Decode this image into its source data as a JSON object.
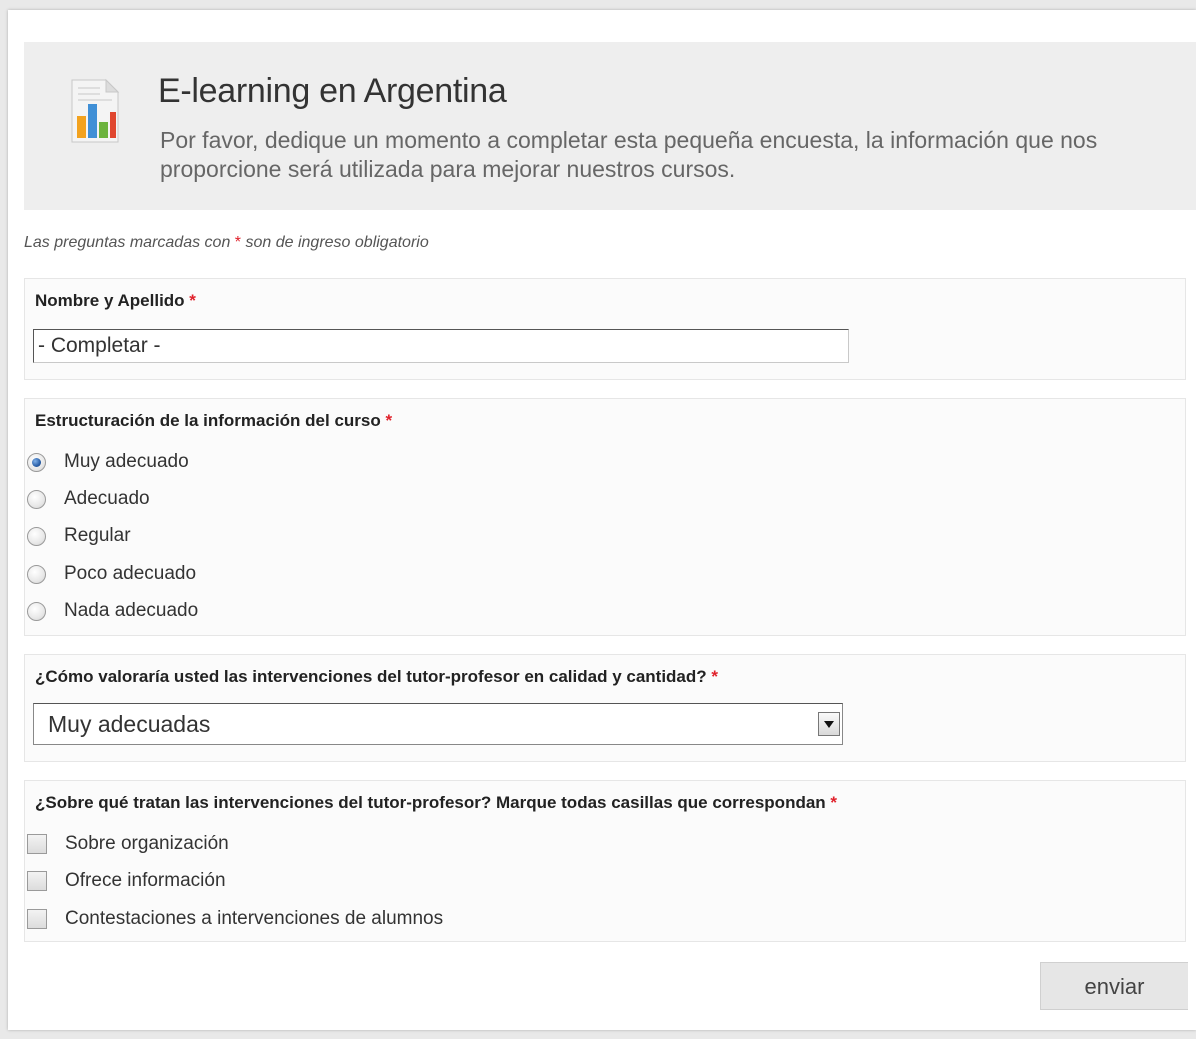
{
  "header": {
    "title": "E-learning en Argentina",
    "subtitle": "Por favor, dedique un momento a completar esta pequeña encuesta, la información que nos proporcione será utilizada para mejorar nuestros cursos.",
    "icon": "survey-chart-icon"
  },
  "required_note": {
    "prefix": "Las preguntas marcadas con",
    "star": "*",
    "suffix": "son de ingreso obligatorio"
  },
  "questions": {
    "name": {
      "label": "Nombre y Apellido",
      "required": "*",
      "value": "- Completar -"
    },
    "structure": {
      "label": "Estructuración de la información del curso",
      "required": "*",
      "options": [
        "Muy adecuado",
        "Adecuado",
        "Regular",
        "Poco adecuado",
        "Nada adecuado"
      ],
      "selected": "Muy adecuado"
    },
    "tutor_rating": {
      "label": "¿Cómo valoraría usted las intervenciones del tutor-profesor en calidad y cantidad?",
      "required": "*",
      "selected": "Muy adecuadas"
    },
    "tutor_topics": {
      "label": "¿Sobre qué tratan las intervenciones del tutor-profesor? Marque todas casillas que correspondan",
      "required": "*",
      "options": [
        "Sobre organización",
        "Ofrece información",
        "Contestaciones a intervenciones de alumnos"
      ],
      "checked": []
    }
  },
  "submit_label": "enviar",
  "colors": {
    "required_star": "#e0212b",
    "header_bg": "#eeeeee",
    "radio_checked": "#2a5fa8"
  }
}
